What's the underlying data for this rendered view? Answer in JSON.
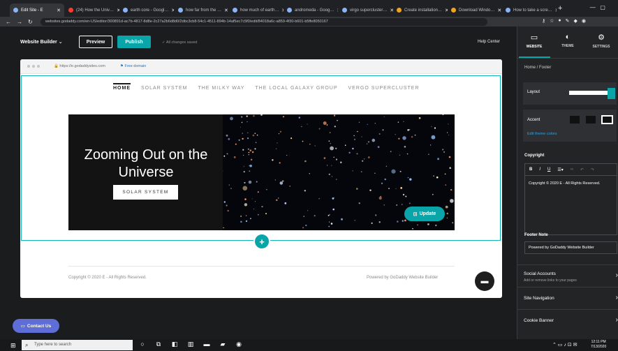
{
  "browser": {
    "tabs": [
      {
        "title": "Edit Site - E",
        "active": true
      },
      {
        "title": "(24) How the Univ…",
        "active": false
      },
      {
        "title": "earth core - Googl…",
        "active": false
      },
      {
        "title": "how far from the …",
        "active": false
      },
      {
        "title": "how much of earth…",
        "active": false
      },
      {
        "title": "andromeda - Goog…",
        "active": false
      },
      {
        "title": "virgo supercluster…",
        "active": false
      },
      {
        "title": "Create installation…",
        "active": false
      },
      {
        "title": "Download Windo…",
        "active": false
      },
      {
        "title": "How to take a scre…",
        "active": false
      }
    ],
    "url": "websites.godaddy.com/en-US/editor/300891d-ac7b-4817-8d8e-2c27a2b6d8d0/2dbc3cb8-54c1-4511-894b-14af5ec7c5f0/edit/84018a6c-a859-4f30-b601-b5ffe8050167"
  },
  "editor": {
    "brand": "Website Builder",
    "preview_label": "Preview",
    "publish_label": "Publish",
    "saved_status": "All changes saved",
    "help_label": "Help Center",
    "frame_url": "https://e.godaddysites.com",
    "free_domain_label": "Free domain",
    "contact_label": "Contact Us"
  },
  "site": {
    "nav": [
      "HOME",
      "SOLAR SYSTEM",
      "THE MILKY WAY",
      "THE LOCAL GALAXY GROUP",
      "VERGO SUPERCLUSTER"
    ],
    "hero_title": "Zooming Out on the Universe",
    "hero_button": "SOLAR SYSTEM",
    "update_label": "Update",
    "footer_copyright": "Copyright © 2020 E - All Rights Reserved.",
    "footer_powered": "Powered by GoDaddy Website Builder"
  },
  "panel": {
    "tabs": [
      {
        "label": "WEBSITE",
        "icon": "website-icon",
        "active": true
      },
      {
        "label": "THEME",
        "icon": "theme-icon",
        "active": false
      },
      {
        "label": "SETTINGS",
        "icon": "settings-icon",
        "active": false
      }
    ],
    "breadcrumb": "Home / Footer",
    "layout_label": "Layout",
    "accent_label": "Accent",
    "edit_theme_colors": "Edit theme colors",
    "copyright_label": "Copyright",
    "copyright_text": "Copyright © 2020 E - All Rights Reserved.",
    "footer_note_label": "Footer Note",
    "footer_note_value": "Powered by GoDaddy Website Builder",
    "rows": [
      {
        "title": "Social Accounts",
        "sub": "Add or remove links to your pages"
      },
      {
        "title": "Site Navigation",
        "sub": ""
      },
      {
        "title": "Cookie Banner",
        "sub": ""
      }
    ]
  },
  "taskbar": {
    "search_placeholder": "Type here to search",
    "time": "12:11 PM",
    "date": "7/13/2020"
  },
  "colors": {
    "accent": "#09a5a8",
    "selection": "#12b5b5",
    "contact": "#5e6ed6"
  }
}
